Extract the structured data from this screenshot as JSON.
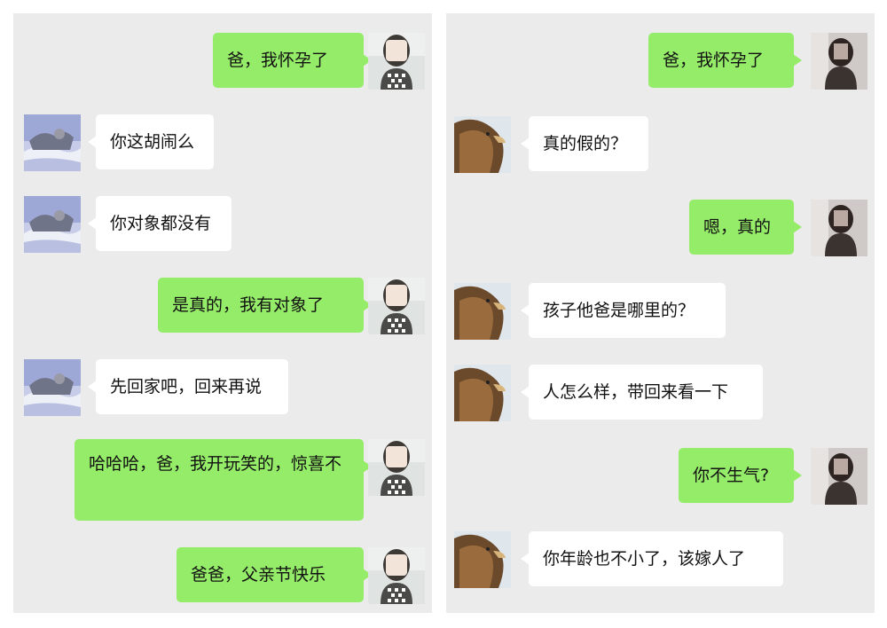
{
  "chat_left": {
    "messages": [
      {
        "side": "out",
        "text": "爸，我怀孕了"
      },
      {
        "side": "in",
        "text": "你这胡闹么"
      },
      {
        "side": "in",
        "text": "你对象都没有"
      },
      {
        "side": "out",
        "text": "是真的，我有对象了"
      },
      {
        "side": "in",
        "text": "先回家吧，回来再说"
      },
      {
        "side": "out",
        "text": "哈哈哈，爸，我开玩笑的，惊喜不"
      },
      {
        "side": "out",
        "text": "爸爸，父亲节快乐"
      }
    ]
  },
  "chat_right": {
    "messages": [
      {
        "side": "out",
        "text": "爸，我怀孕了"
      },
      {
        "side": "in",
        "text": "真的假的？"
      },
      {
        "side": "out",
        "text": "嗯，真的"
      },
      {
        "side": "in",
        "text": "孩子他爸是哪里的？"
      },
      {
        "side": "in",
        "text": "人怎么样，带回来看一下"
      },
      {
        "side": "out",
        "text": "你不生气?"
      },
      {
        "side": "in",
        "text": "你年龄也不小了，该嫁人了"
      }
    ]
  },
  "colors": {
    "outgoing_bubble": "#95ec69",
    "incoming_bubble": "#ffffff",
    "chat_background": "#ebebeb"
  }
}
